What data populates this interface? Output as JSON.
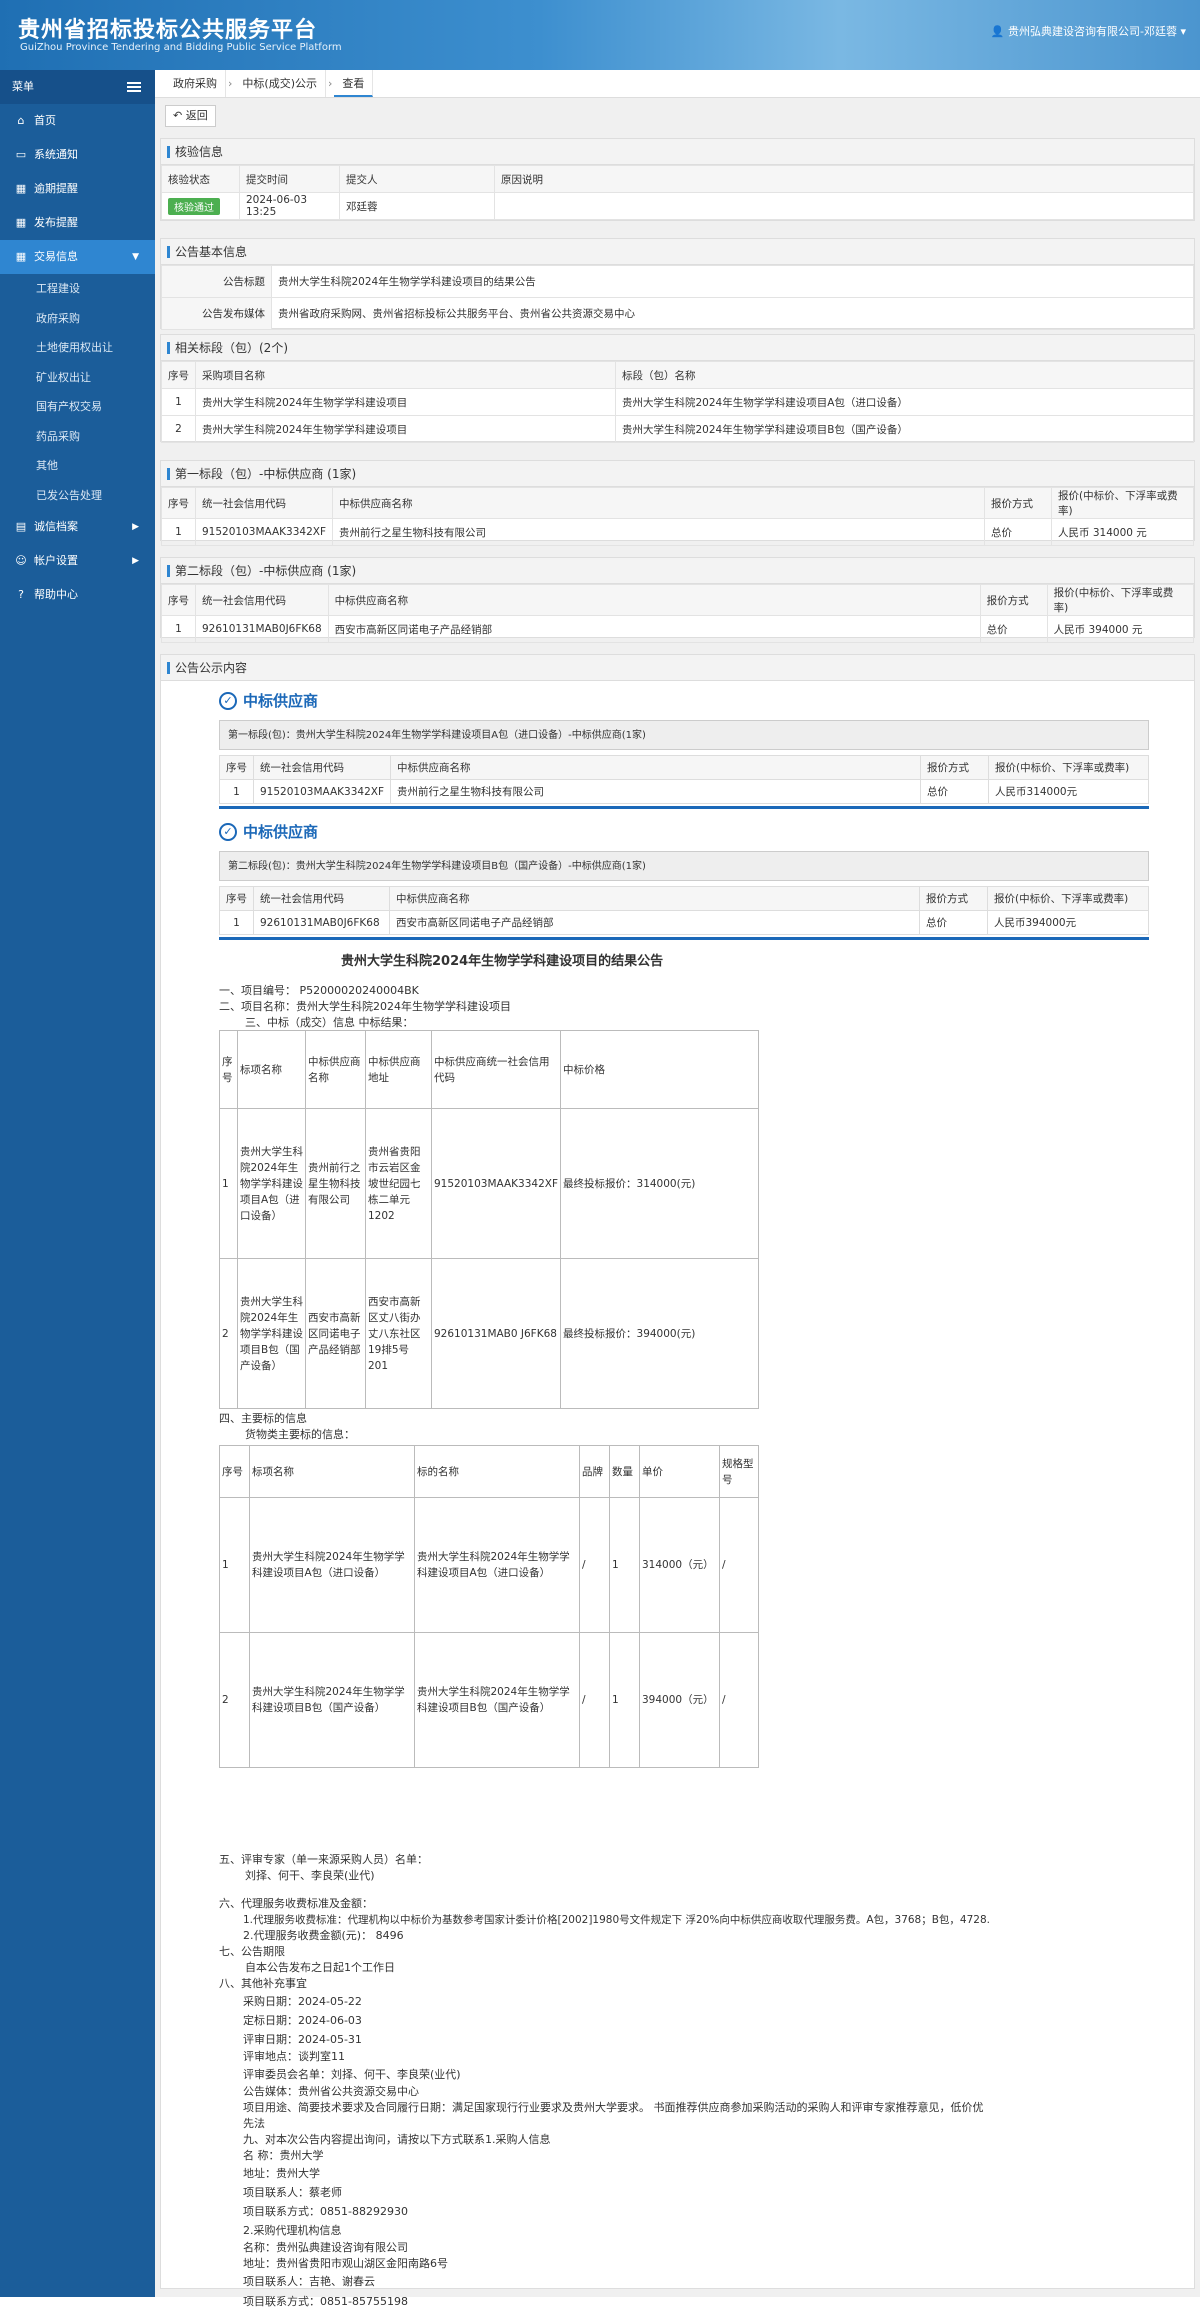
{
  "header": {
    "title": "贵州省招标投标公共服务平台",
    "subtitle": "GuiZhou Province Tendering and Bidding Public Service Platform",
    "user": "贵州弘典建设咨询有限公司-邓廷蓉"
  },
  "sidebar": {
    "menu_label": "菜单",
    "items": [
      {
        "label": "首页",
        "icon": "home-icon"
      },
      {
        "label": "系统通知",
        "icon": "monitor-icon"
      },
      {
        "label": "逾期提醒",
        "icon": "calendar-icon"
      },
      {
        "label": "发布提醒",
        "icon": "calendar-icon"
      },
      {
        "label": "交易信息",
        "icon": "calendar-icon",
        "active": true
      }
    ],
    "subitems": [
      "工程建设",
      "政府采购",
      "土地使用权出让",
      "矿业权出让",
      "国有产权交易",
      "药品采购",
      "其他",
      "已发公告处理"
    ],
    "items2": [
      {
        "label": "诚信档案",
        "icon": "book-icon"
      },
      {
        "label": "帐户设置",
        "icon": "user-icon"
      },
      {
        "label": "帮助中心",
        "icon": "help-icon"
      }
    ]
  },
  "tabs": [
    "政府采购",
    "中标(成交)公示",
    "查看"
  ],
  "back_label": "返回",
  "verify": {
    "title": "核验信息",
    "headers": [
      "核验状态",
      "提交时间",
      "提交人",
      "原因说明"
    ],
    "status": "核验通过",
    "time": "2024-06-03 13:25",
    "person": "邓廷蓉",
    "reason": ""
  },
  "basic": {
    "title": "公告基本信息",
    "title_label": "公告标题",
    "title_value": "贵州大学生科院2024年生物学学科建设项目的结果公告",
    "media_label": "公告发布媒体",
    "media_value": "贵州省政府采购网、贵州省招标投标公共服务平台、贵州省公共资源交易中心"
  },
  "lots": {
    "title": "相关标段（包）(2个)",
    "headers": [
      "序号",
      "采购项目名称",
      "标段（包）名称"
    ],
    "rows": [
      [
        "1",
        "贵州大学生科院2024年生物学学科建设项目",
        "贵州大学生科院2024年生物学学科建设项目A包（进口设备）"
      ],
      [
        "2",
        "贵州大学生科院2024年生物学学科建设项目",
        "贵州大学生科院2024年生物学学科建设项目B包（国产设备）"
      ]
    ]
  },
  "w1": {
    "title": "第一标段（包）-中标供应商 (1家)",
    "headers": [
      "序号",
      "统一社会信用代码",
      "中标供应商名称",
      "报价方式",
      "报价(中标价、下浮率或费率)"
    ],
    "row": [
      "1",
      "91520103MAAK3342XF",
      "贵州前行之星生物科技有限公司",
      "总价",
      "人民币 314000 元"
    ]
  },
  "w2": {
    "title": "第二标段（包）-中标供应商 (1家)",
    "headers": [
      "序号",
      "统一社会信用代码",
      "中标供应商名称",
      "报价方式",
      "报价(中标价、下浮率或费率)"
    ],
    "row": [
      "1",
      "92610131MAB0J6FK68",
      "西安市高新区同诺电子产品经销部",
      "总价",
      "人民币 394000 元"
    ]
  },
  "content": {
    "title": "公告公示内容",
    "heading": "中标供应商",
    "d1_sub": "第一标段(包)：贵州大学生科院2024年生物学学科建设项目A包（进口设备）-中标供应商(1家)",
    "d2_sub": "第二标段(包)：贵州大学生科院2024年生物学学科建设项目B包（国产设备）-中标供应商(1家)",
    "dheaders": [
      "序号",
      "统一社会信用代码",
      "中标供应商名称",
      "报价方式",
      "报价(中标价、下浮率或费率)"
    ],
    "d1_row": [
      "1",
      "91520103MAAK3342XF",
      "贵州前行之星生物科技有限公司",
      "总价",
      "人民币314000元"
    ],
    "d2_row": [
      "1",
      "92610131MAB0J6FK68",
      "西安市高新区同诺电子产品经销部",
      "总价",
      "人民币394000元"
    ]
  },
  "result": {
    "title": "贵州大学生科院2024年生物学学科建设项目的结果公告",
    "l1": "一、项目编号： P52000020240004BK",
    "l2": "二、项目名称：贵州大学生科院2024年生物学学科建设项目",
    "l3": "三、中标（成交）信息    中标结果：",
    "t1_headers": [
      "序号",
      "标项名称",
      "中标供应商名称",
      "中标供应商地址",
      "中标供应商统一社会信用代码",
      "中标价格"
    ],
    "t1_rows": [
      [
        "1",
        "贵州大学生科院2024年生物学学科建设项目A包（进口设备）",
        "贵州前行之星生物科技有限公司",
        "贵州省贵阳市云岩区金坡世纪园七栋二单元1202",
        "91520103MAAK3342XF",
        "最终投标报价：314000(元)"
      ],
      [
        "2",
        "贵州大学生科院2024年生物学学科建设项目B包（国产设备）",
        "西安市高新区同诺电子产品经销部",
        "西安市高新区丈八街办丈八东社区19排5号 201",
        "92610131MAB0 J6FK68",
        "最终投标报价：394000(元)"
      ]
    ],
    "l4": "四、主要标的信息",
    "l4b": "货物类主要标的信息：",
    "t2_headers": [
      "序号",
      "标项名称",
      "标的名称",
      "品牌",
      "数量",
      "单价",
      "规格型号"
    ],
    "t2_rows": [
      [
        "1",
        "贵州大学生科院2024年生物学学科建设项目A包（进口设备）",
        "贵州大学生科院2024年生物学学科建设项目A包（进口设备）",
        "/",
        "1",
        "314000（元）",
        "/"
      ],
      [
        "2",
        "贵州大学生科院2024年生物学学科建设项目B包（国产设备）",
        "贵州大学生科院2024年生物学学科建设项目B包（国产设备）",
        "/",
        "1",
        "394000（元）",
        "/"
      ]
    ],
    "l5": "五、评审专家（单一来源采购人员）名单：",
    "l5b": "刘择、何干、李良荣(业代)",
    "l6": "六、代理服务收费标准及金额：",
    "l6a": "1.代理服务收费标准：代理机构以中标价为基数参考国家计委计价格[2002]1980号文件规定下  浮20%向中标供应商收取代理服务费。A包，3768；B包，4728.",
    "l6b": "2.代理服务收费金额(元)：  8496",
    "l7": "七、公告期限",
    "l7b": "自本公告发布之日起1个工作日",
    "l8": "八、其他补充事宜",
    "l8a": "采购日期：2024-05-22",
    "l8b": "定标日期：2024-06-03",
    "l8c": "评审日期：2024-05-31",
    "l8d": "评审地点：谈判室11",
    "l8e": "评审委员会名单：刘择、何干、李良荣(业代)",
    "l8f": "公告媒体：贵州省公共资源交易中心",
    "l8g": "项目用途、简要技术要求及合同履行日期：满足国家现行行业要求及贵州大学要求。   书面推荐供应商参加采购活动的采购人和评审专家推荐意见，低价优",
    "l8h": "先法",
    "l9": "九、对本次公告内容提出询问，请按以下方式联系1.采购人信息",
    "l9a": "名   称：贵州大学",
    "l9b": "地址：贵州大学",
    "l9c": "项目联系人：蔡老师",
    "l9d": "项目联系方式：0851-88292930",
    "l9e": "2.采购代理机构信息",
    "l9f": "名称：贵州弘典建设咨询有限公司",
    "l9g": "地址：贵州省贵阳市观山湖区金阳南路6号",
    "l9h": "项目联系人：吉艳、谢春云",
    "l9i": "项目联系方式：0851-85755198"
  }
}
